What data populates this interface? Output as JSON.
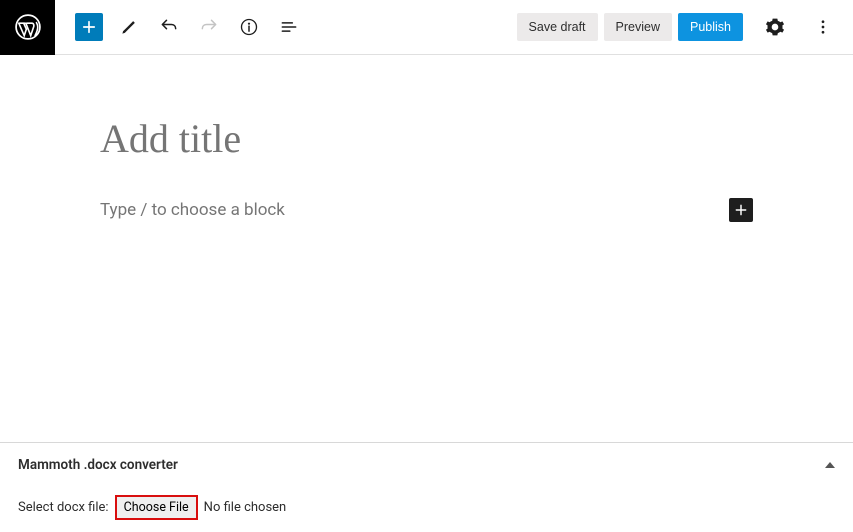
{
  "toolbar": {
    "save_draft": "Save draft",
    "preview": "Preview",
    "publish": "Publish"
  },
  "editor": {
    "title_placeholder": "Add title",
    "block_placeholder": "Type / to choose a block"
  },
  "panel": {
    "title": "Mammoth .docx converter",
    "select_label": "Select docx file:",
    "choose_file": "Choose File",
    "file_status": "No file chosen"
  }
}
